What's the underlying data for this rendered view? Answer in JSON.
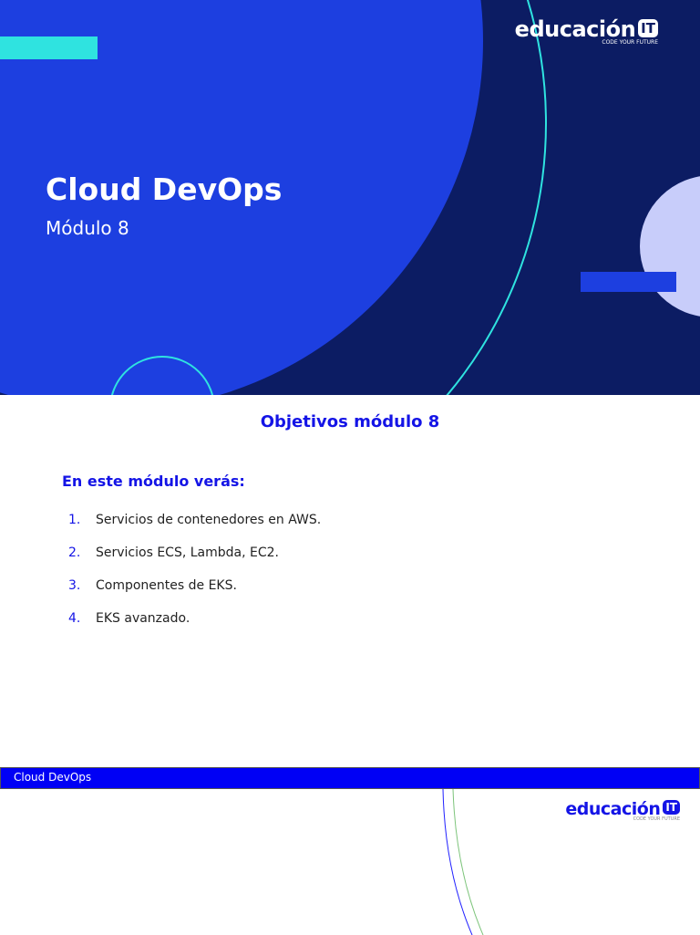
{
  "slide1": {
    "title": "Cloud DevOps",
    "subtitle": "Módulo 8",
    "logo": {
      "word": "educación",
      "badge": "IT",
      "tagline": "CODE YOUR FUTURE"
    }
  },
  "slide2": {
    "heading": "Objetivos módulo 8",
    "intro": "En este módulo verás:",
    "items": [
      {
        "num": "1.",
        "text": "Servicios de contenedores en AWS."
      },
      {
        "num": "2.",
        "text": "Servicios ECS, Lambda, EC2."
      },
      {
        "num": "3.",
        "text": "Componentes de EKS."
      },
      {
        "num": "4.",
        "text": "EKS avanzado."
      }
    ]
  },
  "footer": {
    "label": "Cloud DevOps",
    "logo": {
      "word": "educación",
      "badge": "IT",
      "tagline": "CODE YOUR FUTURE"
    }
  },
  "colors": {
    "navy": "#0c1c63",
    "blue": "#1d3fe0",
    "cyan": "#2fe3e0",
    "accent": "#1414e6"
  }
}
